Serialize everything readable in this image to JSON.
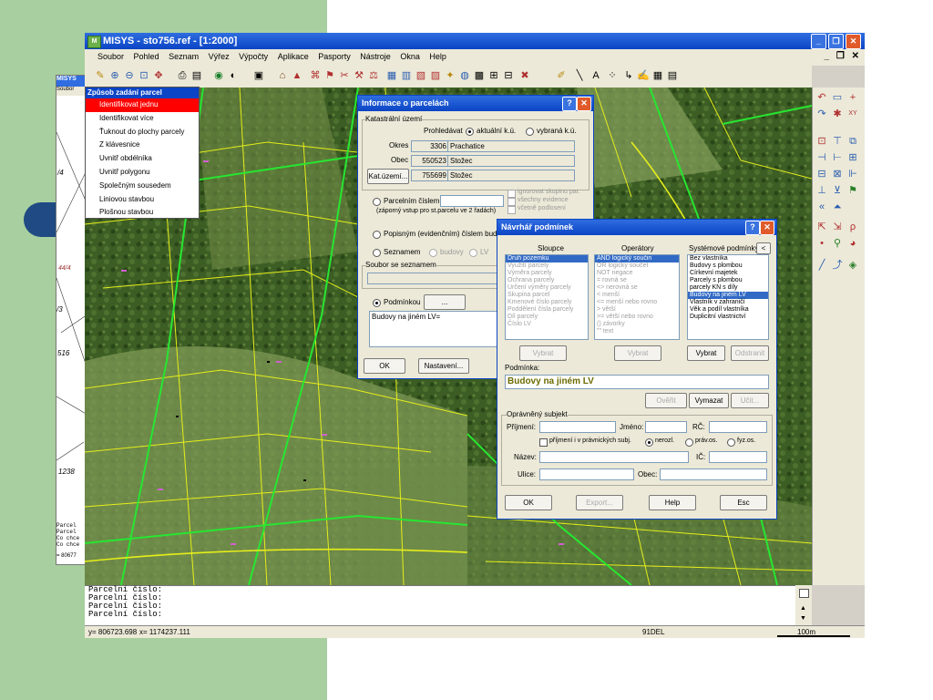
{
  "app": {
    "title": "MISYS - sto756.ref - [1:2000]",
    "icon_text": "M"
  },
  "menubar": [
    "Soubor",
    "Pohled",
    "Seznam",
    "Výřez",
    "Výpočty",
    "Aplikace",
    "Pasporty",
    "Nástroje",
    "Okna",
    "Help"
  ],
  "window_controls": {
    "minimize": "_",
    "restore": "❐",
    "close": "✕"
  },
  "mdi_controls": {
    "minimize": "_",
    "restore": "❐",
    "close": "✕"
  },
  "behind_window": {
    "title": "MISYS",
    "menu": "Soubor",
    "map_labels": [
      "/4",
      "44/4",
      "/3",
      "516",
      "1238"
    ],
    "console": [
      "Parcel",
      "Parcel",
      "Co chce",
      "Co chce"
    ],
    "status": "= 80677"
  },
  "zpusob_menu": {
    "title": "Způsob zadání parcel",
    "items": [
      "Identifikovat jednu",
      "Identifikovat více",
      "Ťuknout do plochy parcely",
      "Z klávesnice",
      "Uvnitř obdélníka",
      "Uvnitř polygonu",
      "Společným sousedem",
      "Liniovou stavbou",
      "Plošnou stavbou"
    ]
  },
  "info_dialog": {
    "title": "Informace o parcelách",
    "katastr_group": "Katastrální území",
    "prohledavat_label": "Prohledávat",
    "radio_aktualni": "aktuální k.ú.",
    "radio_vybrana": "vybraná k.ú.",
    "okres_label": "Okres",
    "okres_code": "3306",
    "okres_name": "Prachatice",
    "obec_label": "Obec",
    "obec_code": "550523",
    "obec_name": "Stožec",
    "katuzemi_button": "Kat.území...",
    "katuzemi_code": "755699",
    "katuzemi_name": "Stožec",
    "parcelnim_cislem": "Parcelním číslem",
    "zaporny": "(záporný vstup pro st.parcelu ve 2 řadách)",
    "ignorovat": "ignorovat skupinu par.",
    "vsechny": "všechny evidence",
    "vcetne": "včetně podlosení",
    "popisnym": "Popisným (evidenčním) číslem budovy",
    "seznamem": "Seznamem",
    "budovy_opt": "budovy",
    "lv_opt": "LV",
    "soubor_group": "Soubor se seznamem",
    "podminkou": "Podmínkou",
    "ellipsis_button": "...",
    "condition_text": "Budovy na jiném LV=",
    "ok_button": "OK",
    "nastaveni_button": "Nastavení..."
  },
  "navrhar_dialog": {
    "title": "Návrhář podmínek",
    "sloupce_header": "Sloupce",
    "operatory_header": "Operátory",
    "system_header": "Systémové podmínky",
    "back_button": "<",
    "sloupce_items": [
      "Druh pozemku",
      "Využití parcely",
      "Výměra parcely",
      "Ochrana parcely",
      "Určení výměry parcely",
      "Skupina parcel",
      "Kmenové číslo parcely",
      "Poddělení čísla parcely",
      "Díl parcely",
      "Číslo LV"
    ],
    "operatory_items": [
      "AND    logický součin",
      "OR     logický součet",
      "NOT    negace",
      "=      rovná se",
      "<>     nerovná se",
      "<      menší",
      "<=     menší nebo rovno",
      ">      větší",
      ">=     větší nebo rovno",
      "()     závorky",
      "\"\"     text"
    ],
    "system_items": [
      "Bez vlastníka",
      "Budovy s plombou",
      "Církevní majetek",
      "Parcely s plombou",
      "parcely KN s díly",
      "Budovy na jiném LV",
      "Vlastník v zahraničí",
      "Věk a podíl vlastníka",
      "Duplicitní vlastnictví"
    ],
    "system_selected": 5,
    "vybrat1": "Vybrat",
    "vybrat2": "Vybrat",
    "vybrat3": "Vybrat",
    "odstranit": "Odstranit",
    "podminka_label": "Podmínka:",
    "podminka_value": "Budovy na jiném LV",
    "overit": "Ověřit",
    "vymazat": "Vymazat",
    "ucit": "Učit...",
    "opravneny_group": "Oprávněný subjekt",
    "prijmeni_label": "Příjmení:",
    "jmeno_label": "Jméno:",
    "rc_label": "RČ:",
    "prijmeni_check": "příjmení i v právnických subj.",
    "nerozl": "nerozl.",
    "prav_os": "práv.os.",
    "fyz_os": "fyz.os.",
    "nazev_label": "Název:",
    "ic_label": "IČ:",
    "ulice_label": "Ulice:",
    "obec_label": "Obec:",
    "ok_button": "OK",
    "export_button": "Export...",
    "help_button": "Help",
    "esc_button": "Esc"
  },
  "console": {
    "lines": [
      "Parcelní číslo:",
      "Parcelní číslo:",
      "Parcelní číslo:",
      "Parcelní číslo:"
    ]
  },
  "statusbar": {
    "y": "y= 806723.698",
    "x": "x= 1174237.111",
    "layer": "91DEL",
    "scale": "100m"
  }
}
